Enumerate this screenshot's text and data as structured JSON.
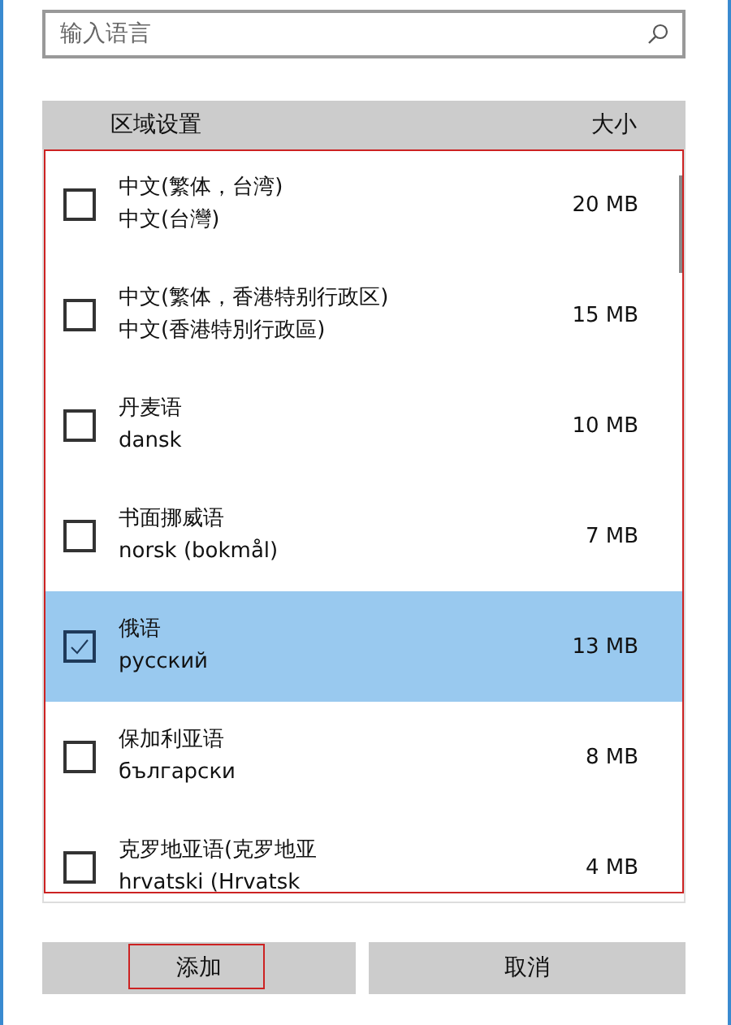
{
  "search": {
    "placeholder": "输入语言"
  },
  "table": {
    "columns": [
      "区域设置",
      "大小"
    ],
    "annotated": true,
    "rows": [
      {
        "name": "中文(繁体，台湾)",
        "native": "中文(台灣)",
        "size": "20 MB",
        "checked": false,
        "selected": false
      },
      {
        "name": "中文(繁体，香港特别行政区)",
        "native": "中文(香港特別行政區)",
        "size": "15 MB",
        "checked": false,
        "selected": false
      },
      {
        "name": "丹麦语",
        "native": "dansk",
        "size": "10 MB",
        "checked": false,
        "selected": false
      },
      {
        "name": "书面挪威语",
        "native": "norsk (bokmål)",
        "size": "7 MB",
        "checked": false,
        "selected": false
      },
      {
        "name": "俄语",
        "native": "русский",
        "size": "13 MB",
        "checked": true,
        "selected": true
      },
      {
        "name": "保加利亚语",
        "native": "български",
        "size": "8 MB",
        "checked": false,
        "selected": false
      },
      {
        "name": "克罗地亚语(克罗地亚",
        "native": "hrvatski (Hrvatsk",
        "size": "4 MB",
        "checked": false,
        "selected": false
      }
    ]
  },
  "buttons": [
    {
      "label": "添加",
      "annotated": true
    },
    {
      "label": "取消",
      "annotated": false
    }
  ]
}
